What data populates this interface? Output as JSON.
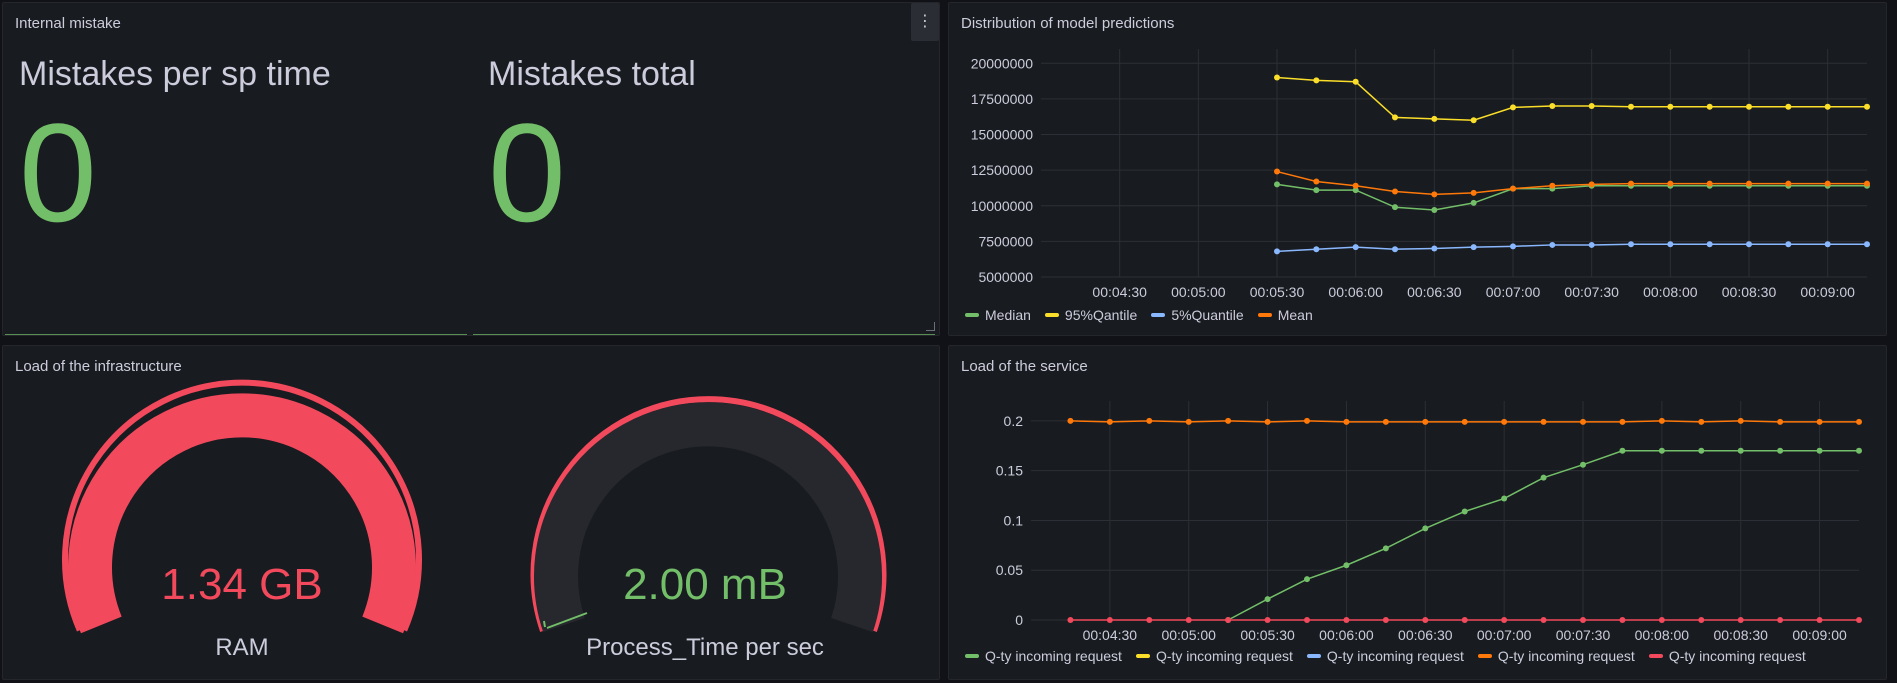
{
  "panels": {
    "internal": {
      "title": "Internal mistake",
      "menu_glyph": "⋮",
      "stat1": {
        "title": "Mistakes per sp time",
        "value": "0"
      },
      "stat2": {
        "title": "Mistakes total",
        "value": "0"
      }
    },
    "distribution": {
      "title": "Distribution of model predictions"
    },
    "infra": {
      "title": "Load of the infrastructure",
      "gauge1": {
        "value": "1.34 GB",
        "label": "RAM",
        "fraction": 1.0,
        "color": "#f2495c"
      },
      "gauge2": {
        "value": "2.00 mB",
        "label": "Process_Time per sec",
        "fraction": 0.02,
        "color": "#73bf69",
        "threshold_color": "#f2495c"
      }
    },
    "service": {
      "title": "Load of the service"
    }
  },
  "colors": {
    "green": "#73bf69",
    "yellow": "#fade2a",
    "blue": "#8ab8ff",
    "orange": "#ff780a",
    "red": "#f2495c",
    "grid": "#2c2f35",
    "text": "#ccccdc"
  },
  "chart_data": [
    {
      "type": "line",
      "title": "Distribution of model predictions",
      "x": [
        "00:05:30",
        "00:05:45",
        "00:06:00",
        "00:06:15",
        "00:06:30",
        "00:06:45",
        "00:07:00",
        "00:07:15",
        "00:07:30",
        "00:07:45",
        "00:08:00",
        "00:08:15",
        "00:08:30",
        "00:08:45",
        "00:09:00",
        "00:09:15"
      ],
      "xticks": [
        "00:04:30",
        "00:05:00",
        "00:05:30",
        "00:06:00",
        "00:06:30",
        "00:07:00",
        "00:07:30",
        "00:08:00",
        "00:08:30",
        "00:09:00"
      ],
      "yticks": [
        "5000000",
        "7500000",
        "10000000",
        "12500000",
        "15000000",
        "17500000",
        "20000000"
      ],
      "ylim": [
        5000000,
        21000000
      ],
      "series": [
        {
          "name": "Median",
          "color": "#73bf69",
          "values": [
            11500000,
            11100000,
            11100000,
            9900000,
            9700000,
            10200000,
            11200000,
            11200000,
            11400000,
            11400000,
            11400000,
            11400000,
            11400000,
            11400000,
            11400000,
            11400000
          ]
        },
        {
          "name": "95%Qantile",
          "color": "#fade2a",
          "values": [
            19000000,
            18800000,
            18700000,
            16200000,
            16100000,
            16000000,
            16900000,
            17000000,
            17000000,
            16950000,
            16950000,
            16950000,
            16950000,
            16950000,
            16950000,
            16950000
          ]
        },
        {
          "name": "5%Quantile",
          "color": "#8ab8ff",
          "values": [
            6800000,
            6950000,
            7100000,
            6950000,
            7000000,
            7100000,
            7150000,
            7250000,
            7250000,
            7300000,
            7300000,
            7300000,
            7300000,
            7300000,
            7300000,
            7300000
          ]
        },
        {
          "name": "Mean",
          "color": "#ff780a",
          "values": [
            12400000,
            11700000,
            11400000,
            11000000,
            10800000,
            10900000,
            11200000,
            11400000,
            11500000,
            11550000,
            11550000,
            11550000,
            11550000,
            11550000,
            11550000,
            11550000
          ]
        }
      ]
    },
    {
      "type": "line",
      "title": "Load of the service",
      "x": [
        "00:04:15",
        "00:04:30",
        "00:04:45",
        "00:05:00",
        "00:05:15",
        "00:05:30",
        "00:05:45",
        "00:06:00",
        "00:06:15",
        "00:06:30",
        "00:06:45",
        "00:07:00",
        "00:07:15",
        "00:07:30",
        "00:07:45",
        "00:08:00",
        "00:08:15",
        "00:08:30",
        "00:08:45",
        "00:09:00",
        "00:09:15"
      ],
      "xticks": [
        "00:04:30",
        "00:05:00",
        "00:05:30",
        "00:06:00",
        "00:06:30",
        "00:07:00",
        "00:07:30",
        "00:08:00",
        "00:08:30",
        "00:09:00"
      ],
      "yticks": [
        "0",
        "0.05",
        "0.1",
        "0.15",
        "0.2"
      ],
      "ylim": [
        0,
        0.22
      ],
      "series": [
        {
          "name": "Q-ty incoming request",
          "color": "#73bf69",
          "values": [
            null,
            null,
            null,
            null,
            0,
            0.021,
            0.041,
            0.055,
            0.072,
            0.092,
            0.109,
            0.122,
            0.143,
            0.156,
            0.17,
            0.17,
            0.17,
            0.17,
            0.17,
            0.17,
            0.17
          ]
        },
        {
          "name": "Q-ty incoming request",
          "color": "#fade2a",
          "values": []
        },
        {
          "name": "Q-ty incoming request",
          "color": "#8ab8ff",
          "values": []
        },
        {
          "name": "Q-ty incoming request",
          "color": "#ff780a",
          "values": [
            0.2,
            0.199,
            0.2,
            0.199,
            0.2,
            0.199,
            0.2,
            0.199,
            0.199,
            0.199,
            0.199,
            0.199,
            0.199,
            0.199,
            0.199,
            0.2,
            0.199,
            0.2,
            0.199,
            0.199,
            0.199
          ]
        },
        {
          "name": "Q-ty incoming request",
          "color": "#f2495c",
          "values": [
            0,
            0,
            0,
            0,
            0,
            0,
            0,
            0,
            0,
            0,
            0,
            0,
            0,
            0,
            0,
            0,
            0,
            0,
            0,
            0,
            0
          ]
        }
      ]
    }
  ]
}
